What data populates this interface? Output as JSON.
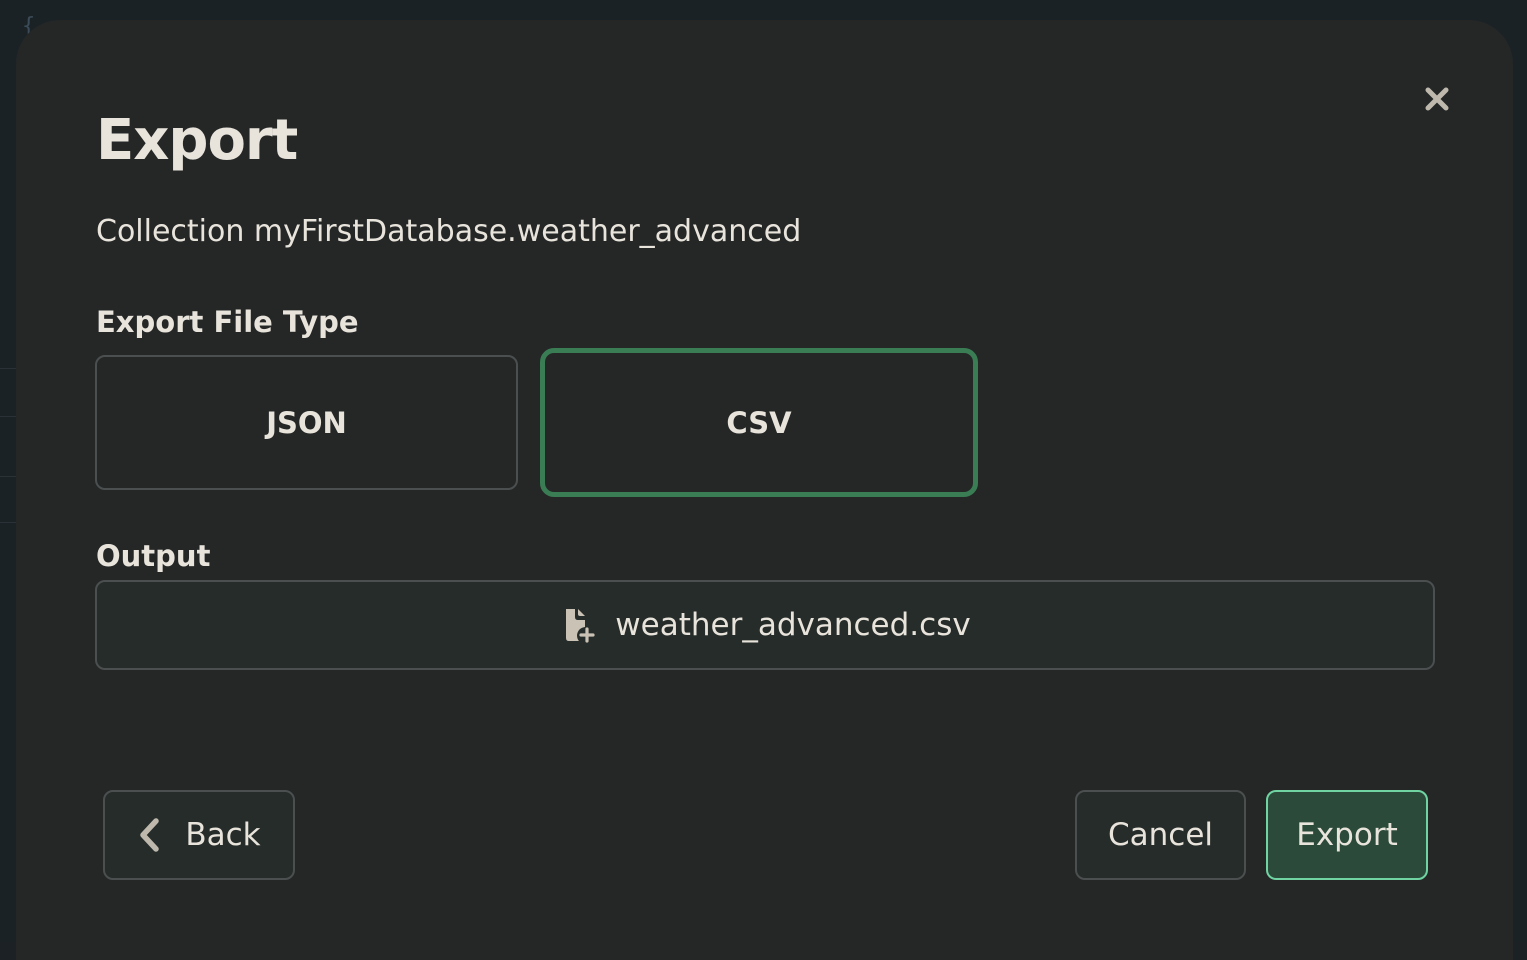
{
  "modal": {
    "title": "Export",
    "subtitle": "Collection myFirstDatabase.weather_advanced",
    "file_type_label": "Export File Type",
    "file_types": [
      {
        "label": "JSON",
        "selected": false
      },
      {
        "label": "CSV",
        "selected": true
      }
    ],
    "output_label": "Output",
    "output_filename": "weather_advanced.csv",
    "buttons": {
      "back": "Back",
      "cancel": "Cancel",
      "export": "Export"
    }
  },
  "icons": {
    "close": "close-icon",
    "file_add": "file-add-icon",
    "back": "chevron-left-icon"
  },
  "colors": {
    "modal_bg": "#252727",
    "text": "#e8e4dc",
    "selected_border": "#3a7d54",
    "primary_bg": "#2b4a3a",
    "primary_border": "#6fd3a2",
    "border": "#4b4f4f"
  }
}
